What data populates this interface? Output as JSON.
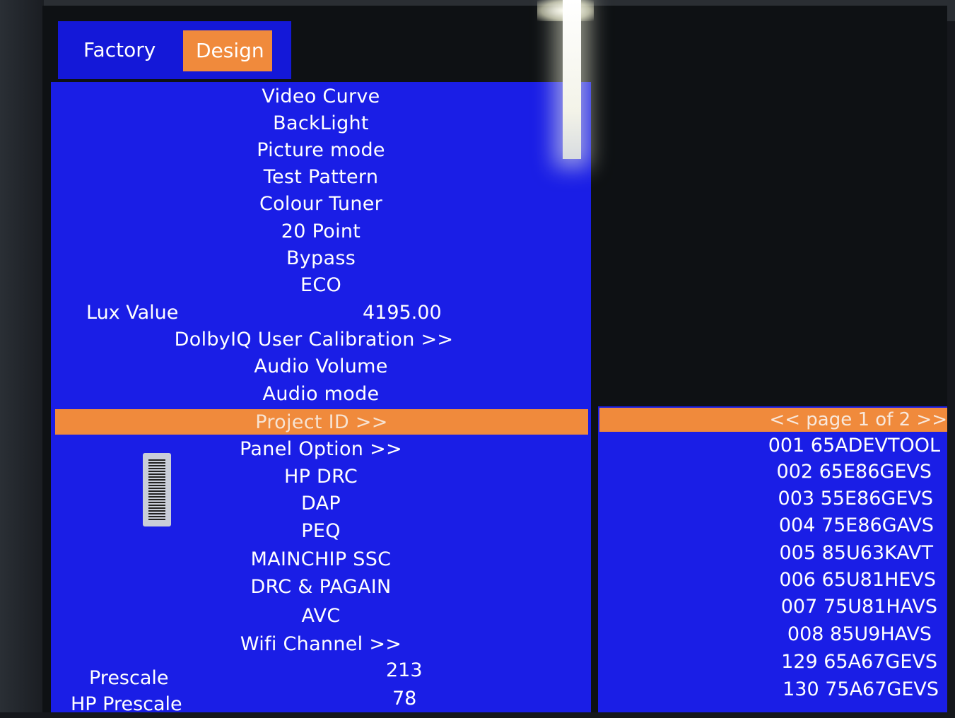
{
  "tabs": {
    "factory_label": "Factory",
    "design_label": "Design"
  },
  "menu": {
    "items": [
      "Video Curve",
      "BackLight",
      "Picture mode",
      "Test Pattern",
      "Colour Tuner",
      "20 Point",
      "Bypass",
      "ECO",
      "",
      "DolbyIQ User Calibration >>",
      "Audio Volume",
      "Audio mode",
      "Project ID >>",
      "Panel Option >>",
      "HP DRC",
      "DAP",
      "PEQ",
      "MAINCHIP SSC",
      "DRC & PAGAIN",
      "AVC",
      "Wifi Channel >>"
    ],
    "lux_label": "Lux Value",
    "lux_value": "4195.00",
    "prescale_label": "Prescale",
    "prescale_value": "213",
    "hp_prescale_label": "HP Prescale",
    "hp_prescale_value": "78"
  },
  "project_list": {
    "header": "<<  page 1 of 2  >>",
    "items": [
      "001 65ADEVTOOL",
      "002 65E86GEVS",
      "003 55E86GEVS",
      "004 75E86GAVS",
      "005 85U63KAVT",
      "006 65U81HEVS",
      "007 75U81HAVS",
      "008 85U9HAVS",
      "129 65A67GEVS",
      "130 75A67GEVS"
    ]
  },
  "colors": {
    "menu_blue": "#1a1ee6",
    "highlight_orange": "#f08a3c",
    "text": "#ffffff"
  }
}
